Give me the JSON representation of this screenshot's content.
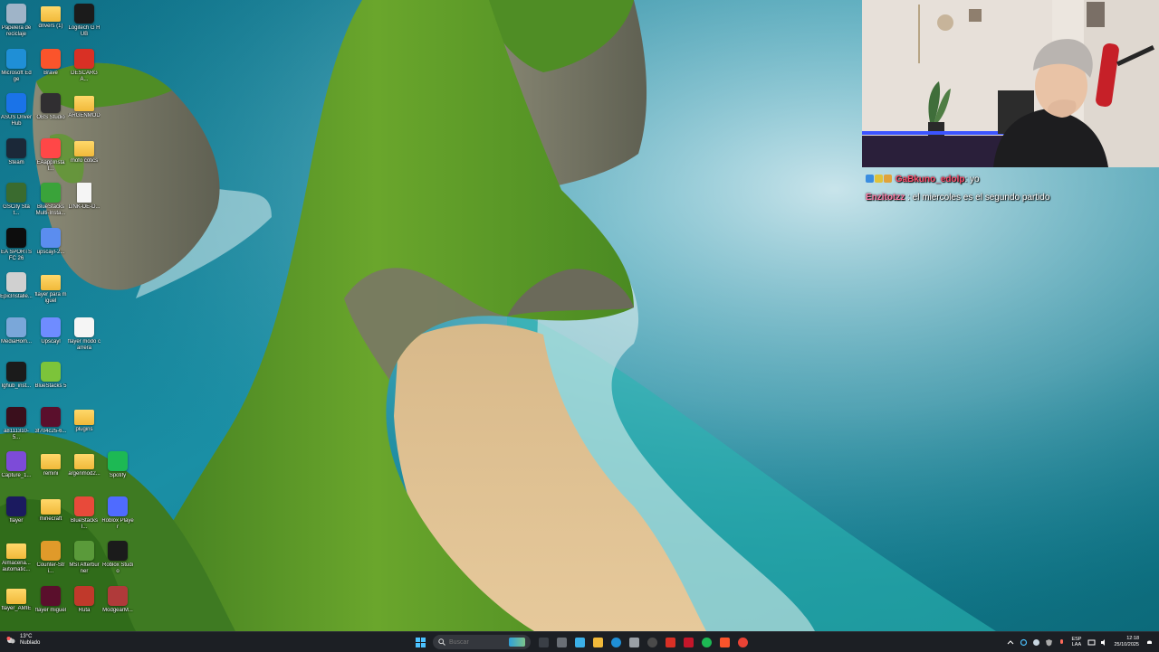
{
  "desktop": {
    "icons": [
      {
        "label": "Papelera de reciclaje",
        "icon": "recycle-bin-icon",
        "color": "#9fb4c8"
      },
      {
        "label": "drivers (1)",
        "icon": "folder-icon",
        "color": "#f1b93a"
      },
      {
        "label": "Logitech G HUB",
        "icon": "logitech-g-icon",
        "color": "#1b1b1b"
      },
      {
        "label": "Microsoft Edge",
        "icon": "edge-icon",
        "color": "#1f8fd6"
      },
      {
        "label": "Brave",
        "icon": "brave-icon",
        "color": "#fb542b"
      },
      {
        "label": "DESCARGA...",
        "icon": "pdf-icon",
        "color": "#d93025"
      },
      {
        "label": "ASUS DriverHub",
        "icon": "asus-driverhub-icon",
        "color": "#1a73e8"
      },
      {
        "label": "OBS Studio",
        "icon": "obs-icon",
        "color": "#302e31"
      },
      {
        "label": "ARGENMOD",
        "icon": "folder-icon",
        "color": "#f1b93a"
      },
      {
        "label": "Steam",
        "icon": "steam-icon",
        "color": "#1b2838"
      },
      {
        "label": "EAappInstal...",
        "icon": "ea-icon",
        "color": "#ff4747"
      },
      {
        "label": "mofo cotics",
        "icon": "folder-icon",
        "color": "#f1b93a"
      },
      {
        "label": "GSCity Stat...",
        "icon": "gta-icon",
        "color": "#3a6b2f"
      },
      {
        "label": "BlueStacks Multi-Insta...",
        "icon": "bluestacks-multi-icon",
        "color": "#3aa33a"
      },
      {
        "label": "LINK-DE-D...",
        "icon": "text-file-icon",
        "color": "#f5f5f5"
      },
      {
        "label": "EA SPORTS FC 26",
        "icon": "ea-sports-fc-icon",
        "color": "#0d0d0d"
      },
      {
        "label": "upscayl-2...",
        "icon": "upscayl-file-icon",
        "color": "#5b8def"
      },
      {
        "label": "EpicInstalle...",
        "icon": "epic-installer-icon",
        "color": "#d0d0d0"
      },
      {
        "label": "flayer para miguel",
        "icon": "folder-icon",
        "color": "#f1b93a"
      },
      {
        "label": "MediaHom...",
        "icon": "media-home-icon",
        "color": "#7aa7d9"
      },
      {
        "label": "Upscayl",
        "icon": "upscayl-icon",
        "color": "#6f8cff"
      },
      {
        "label": "flayer modo carrera",
        "icon": "image-file-icon",
        "color": "#f5f5f5"
      },
      {
        "label": "lghub_inst...",
        "icon": "logitech-installer-icon",
        "color": "#1b1b1b"
      },
      {
        "label": "BlueStacks 5",
        "icon": "bluestacks-icon",
        "color": "#7cc43a"
      },
      {
        "label": "a8111310-5...",
        "icon": "image-file-icon",
        "color": "#3a0f1c"
      },
      {
        "label": "3f704c25-6...",
        "icon": "image-file-icon",
        "color": "#5a0f2c"
      },
      {
        "label": "plugins",
        "icon": "folder-icon",
        "color": "#f1b93a"
      },
      {
        "label": "Capture_1...",
        "icon": "capture-icon",
        "color": "#7d4bd8"
      },
      {
        "label": "remini",
        "icon": "folder-icon",
        "color": "#f1b93a"
      },
      {
        "label": "argenmod2...",
        "icon": "folder-icon",
        "color": "#f1b93a"
      },
      {
        "label": "Spotify",
        "icon": "spotify-icon",
        "color": "#1db954"
      },
      {
        "label": "flayer",
        "icon": "after-effects-icon",
        "color": "#1b1a5f"
      },
      {
        "label": "minecraft",
        "icon": "folder-icon",
        "color": "#f1b93a"
      },
      {
        "label": "BlueStacksI...",
        "icon": "bluestacks-store-icon",
        "color": "#e84a3a"
      },
      {
        "label": "Roblox Player",
        "icon": "roblox-player-icon",
        "color": "#4f6bff"
      },
      {
        "label": "Almacena... automatic...",
        "icon": "folder-icon",
        "color": "#f1b93a"
      },
      {
        "label": "Counter-Stri...",
        "icon": "counter-strike-icon",
        "color": "#e09a2a"
      },
      {
        "label": "MSI Afterburner",
        "icon": "msi-afterburner-icon",
        "color": "#5a9a3a"
      },
      {
        "label": "Roblox Studio",
        "icon": "roblox-studio-icon",
        "color": "#1b1b1b"
      },
      {
        "label": "flayer_AMIE",
        "icon": "folder-icon",
        "color": "#f1b93a"
      },
      {
        "label": "flayer miguel",
        "icon": "image-file-icon",
        "color": "#5a0f2c"
      },
      {
        "label": "Ruta",
        "icon": "ruta-icon",
        "color": "#c0392b"
      },
      {
        "label": "ModgearM...",
        "icon": "modgear-icon",
        "color": "#b03a3a"
      }
    ]
  },
  "stream": {
    "chat": [
      {
        "user": "GaBkuno_edolp",
        "message": ": yo"
      },
      {
        "user": "Enzitotzz",
        "message": " : el miercoles es el segundo partido"
      }
    ]
  },
  "taskbar": {
    "weather": {
      "temp": "13°C",
      "condition": "Nublado"
    },
    "search_placeholder": "Buscar",
    "apps": [
      "file-explorer-icon",
      "task-view-icon",
      "copilot-icon",
      "folder-icon",
      "edge-icon",
      "pen-icon",
      "obs-icon",
      "recorder-icon",
      "msi-icon",
      "spotify-icon",
      "brave-icon",
      "chrome-icon"
    ],
    "language": {
      "lang": "ESP",
      "layout": "LAA"
    },
    "clock": {
      "time": "12:18",
      "date": "25/10/2025"
    }
  }
}
